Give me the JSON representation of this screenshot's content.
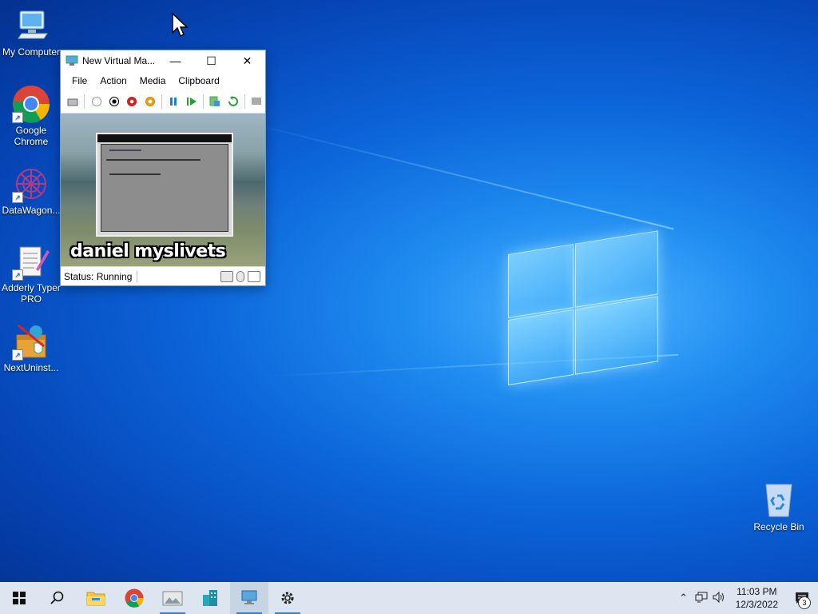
{
  "desktop": {
    "icons": [
      {
        "label": "My Computer"
      },
      {
        "label": "Google Chrome"
      },
      {
        "label": "DataWagon..."
      },
      {
        "label": "Adderly Typer PRO"
      },
      {
        "label": "NextUninst..."
      },
      {
        "label": "Recycle Bin"
      }
    ]
  },
  "vm_window": {
    "title": "New Virtual Ma...",
    "menu": [
      "File",
      "Action",
      "Media",
      "Clipboard"
    ],
    "overlay_text": "daniel myslivets",
    "status": "Status: Running"
  },
  "taskbar": {
    "time": "11:03 PM",
    "date": "12/3/2022",
    "notification_count": "3"
  },
  "colors": {
    "taskbar_bg": "#dde6f0",
    "accent": "#3a7bd5"
  }
}
